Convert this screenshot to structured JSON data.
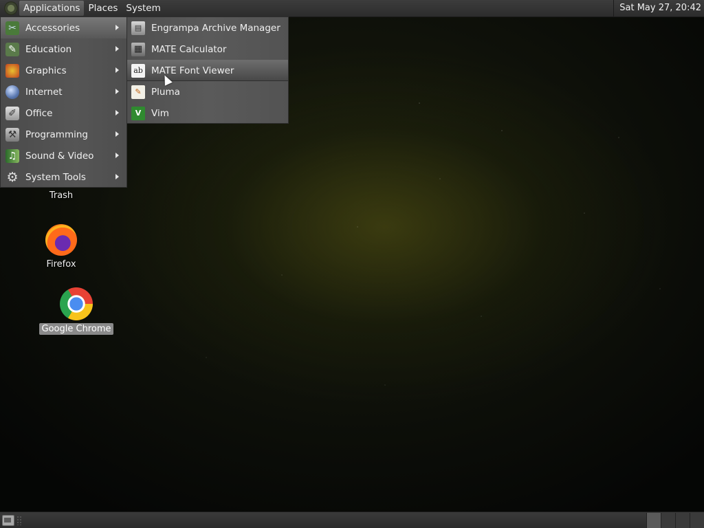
{
  "top_panel": {
    "menus": [
      "Applications",
      "Places",
      "System"
    ],
    "clock": "Sat May 27, 20:42"
  },
  "desktop_icons": [
    {
      "label": "Trash"
    },
    {
      "label": "Firefox"
    },
    {
      "label": "Google Chrome"
    }
  ],
  "applications_menu": {
    "categories": [
      {
        "label": "Accessories",
        "icon": "accessories-icon"
      },
      {
        "label": "Education",
        "icon": "education-icon"
      },
      {
        "label": "Graphics",
        "icon": "graphics-icon"
      },
      {
        "label": "Internet",
        "icon": "internet-icon"
      },
      {
        "label": "Office",
        "icon": "office-icon"
      },
      {
        "label": "Programming",
        "icon": "programming-icon"
      },
      {
        "label": "Sound & Video",
        "icon": "sound-video-icon"
      },
      {
        "label": "System Tools",
        "icon": "system-tools-icon"
      }
    ],
    "active_category": "Accessories"
  },
  "accessories_submenu": {
    "items": [
      {
        "label": "Engrampa Archive Manager",
        "icon": "archive-manager-icon"
      },
      {
        "label": "MATE Calculator",
        "icon": "calculator-icon"
      },
      {
        "label": "MATE Font Viewer",
        "icon": "font-viewer-icon"
      },
      {
        "label": "Pluma",
        "icon": "text-editor-icon"
      },
      {
        "label": "Vim",
        "icon": "vim-icon"
      }
    ],
    "hovered_item": "MATE Font Viewer"
  },
  "colors": {
    "panel": "#2f2f2f",
    "menu_bg": "#505050",
    "highlight": "#6a6a6a"
  }
}
